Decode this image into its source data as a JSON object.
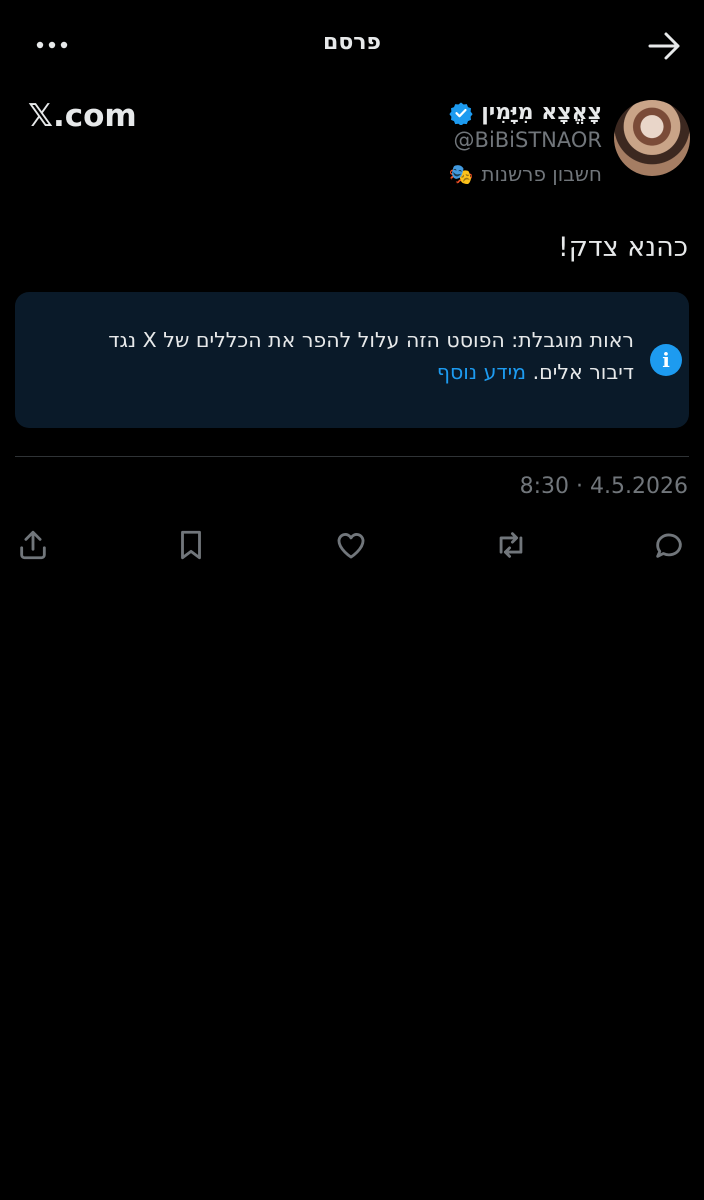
{
  "header": {
    "title": "פרסם"
  },
  "profile": {
    "name": "צָאֱצָא מִיָּמִין",
    "handle": "@BiBiSTNAOR",
    "account_label": "חשבון פרשנות",
    "account_label_icon": "🎭"
  },
  "brand": {
    "x": "𝕏",
    "suffix": ".com"
  },
  "post": {
    "text": "כהנא צדק!"
  },
  "notice": {
    "text": "ראות מוגבלת: הפוסט הזה עלול להפר את הכללים של X נגד דיבור אלים.",
    "link": "מידע נוסף"
  },
  "meta": {
    "timestamp": "8:30 · 4.5.2026"
  },
  "colors": {
    "accent": "#1d9bf0",
    "muted": "#71767b",
    "notice_bg": "#0a1a29"
  }
}
